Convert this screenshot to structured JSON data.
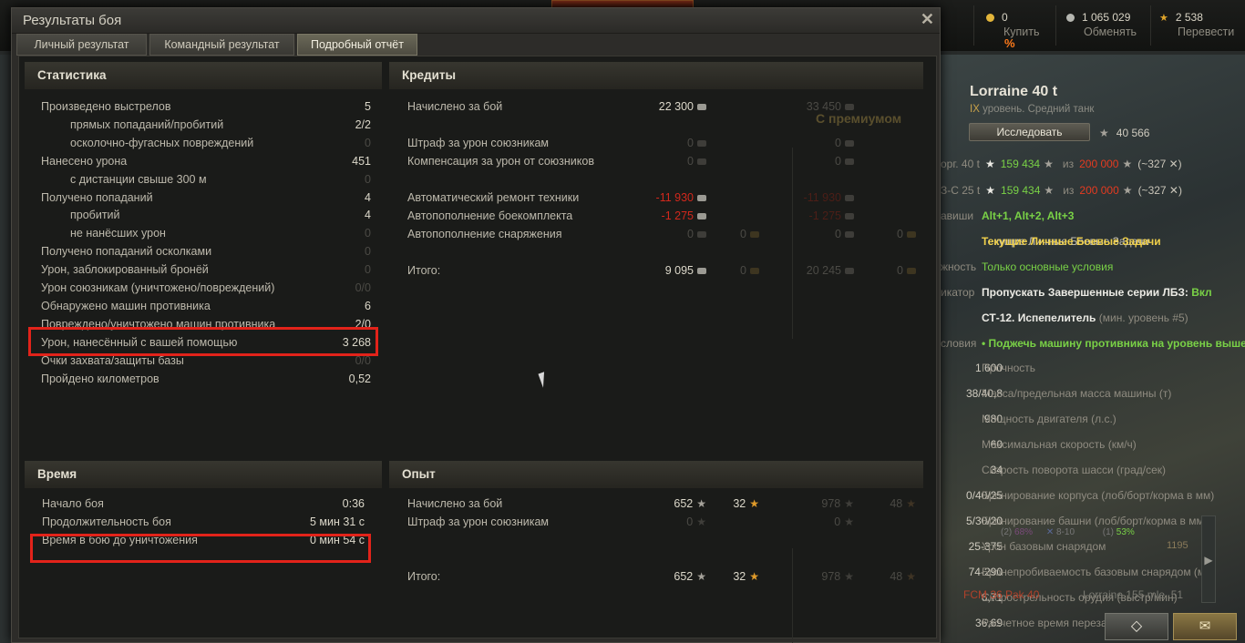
{
  "topbar": {
    "gold": {
      "value": "0",
      "action": "Купить",
      "discount": "%"
    },
    "silver": {
      "value": "1 065 029",
      "action": "Обменять"
    },
    "free_xp": {
      "value": "2 538",
      "action": "Перевести"
    }
  },
  "vehicle": {
    "name": "Lorraine 40 t",
    "tier": "IX",
    "subtitle": "уровень. Средний танк",
    "research_label": "Исследовать",
    "research_xp": "40 566",
    "compare_rows": [
      {
        "label": "орг. 40 t",
        "value": "159 434",
        "of": "из",
        "total": "200 000",
        "diff": "(~327 ✕)"
      },
      {
        "label": "З-С 25 t",
        "value": "159 434",
        "of": "из",
        "total": "200 000",
        "diff": "(~327 ✕)"
      }
    ],
    "hotkeys_label": "авиши",
    "hotkeys": "Alt+1, Alt+2, Alt+3",
    "missions_title": "Текущие Личные Боевые Задачи",
    "difficulty_label": "жность",
    "difficulty": "Только основные условия",
    "indicator_label": "икатор",
    "indicator": "Пропускать Завершенные серии ЛБЗ:",
    "indicator_value": "Вкл",
    "mission": "СТ-12. Испепелитель",
    "mission_min": "(мин. уровень #5)",
    "conditions_label": "словия",
    "condition": "• Поджечь машину противника на уровень выше.",
    "specs": [
      {
        "num": "1 600",
        "label": "Прочность"
      },
      {
        "num": "38/40,8",
        "label": "Масса/предельная масса машины (т)"
      },
      {
        "num": "980",
        "label": "Мощность двигателя (л.с.)"
      },
      {
        "num": "60",
        "label": "Максимальная скорость (км/ч)"
      },
      {
        "num": "34",
        "label": "Скорость поворота шасси (град/сек)"
      },
      {
        "num": "0/40/25",
        "label": "Бронирование корпуса (лоб/борт/корма в мм)"
      },
      {
        "num": "5/30/20",
        "label": "Бронирование башни (лоб/борт/корма в мм)"
      },
      {
        "num": "25-375",
        "label": "Урон базовым снарядом"
      },
      {
        "num": "74-290",
        "label": "Бронепробиваемость базовым снарядом (мм)"
      },
      {
        "num": "6,71",
        "label": "Скорострельность орудия (выстр/мин)"
      },
      {
        "num": "36,69",
        "label": "Расчетное время перезар"
      }
    ],
    "overlay": {
      "a": "(2)",
      "b": "68%",
      "c": "8-10",
      "d": "(1)",
      "e": "53%",
      "f": "1195",
      "gun": "FCM 36 Pak 40",
      "gun2": "Lorraine 155 mle. 51"
    }
  },
  "dialog": {
    "title": "Результаты боя",
    "close": "✕",
    "tabs": [
      "Личный результат",
      "Командный результат",
      "Подробный отчёт"
    ],
    "stats": {
      "header": "Статистика",
      "rows": [
        {
          "label": "Произведено выстрелов",
          "value": "5",
          "indent": false,
          "dim": false
        },
        {
          "label": "прямых попаданий/пробитий",
          "value": "2/2",
          "indent": true,
          "dim": false
        },
        {
          "label": "осколочно-фугасных повреждений",
          "value": "0",
          "indent": true,
          "dim": true
        },
        {
          "label": "Нанесено урона",
          "value": "451",
          "indent": false,
          "dim": false
        },
        {
          "label": "с дистанции свыше 300 м",
          "value": "0",
          "indent": true,
          "dim": true
        },
        {
          "label": "Получено попаданий",
          "value": "4",
          "indent": false,
          "dim": false
        },
        {
          "label": "пробитий",
          "value": "4",
          "indent": true,
          "dim": false
        },
        {
          "label": "не нанёсших урон",
          "value": "0",
          "indent": true,
          "dim": true
        },
        {
          "label": "Получено попаданий осколками",
          "value": "0",
          "indent": false,
          "dim": true
        },
        {
          "label": "Урон, заблокированный бронёй",
          "value": "0",
          "indent": false,
          "dim": true
        },
        {
          "label": "Урон союзникам (уничтожено/повреждений)",
          "value": "0/0",
          "indent": false,
          "dim": true
        },
        {
          "label": "Обнаружено машин противника",
          "value": "6",
          "indent": false,
          "dim": false
        },
        {
          "label": "Повреждено/уничтожено машин противника",
          "value": "2/0",
          "indent": false,
          "dim": false
        },
        {
          "label": "Урон, нанесённый с вашей помощью",
          "value": "3 268",
          "indent": false,
          "dim": false
        },
        {
          "label": "Очки захвата/защиты базы",
          "value": "0/0",
          "indent": false,
          "dim": true
        },
        {
          "label": "Пройдено километров",
          "value": "0,52",
          "indent": false,
          "dim": false
        }
      ]
    },
    "credits": {
      "header": "Кредиты",
      "premium_label": "С премиумом",
      "rows": [
        {
          "label": "Начислено за бой",
          "c": "22 300",
          "g": "",
          "pc": "33 450",
          "pg": ""
        },
        {
          "label": "Штраф за урон союзникам",
          "c": "0",
          "g": "",
          "pc": "0",
          "pg": ""
        },
        {
          "label": "Компенсация за урон от союзников",
          "c": "0",
          "g": "",
          "pc": "0",
          "pg": ""
        },
        {
          "label": "Автоматический ремонт техники",
          "c": "-11 930",
          "g": "",
          "pc": "-11 930",
          "pg": ""
        },
        {
          "label": "Автопополнение боекомплекта",
          "c": "-1 275",
          "g": "",
          "pc": "-1 275",
          "pg": ""
        },
        {
          "label": "Автопополнение снаряжения",
          "c": "0",
          "g": "0",
          "pc": "0",
          "pg": "0"
        },
        {
          "label": "Итого:",
          "c": "9 095",
          "g": "0",
          "pc": "20 245",
          "pg": "0"
        }
      ]
    },
    "time": {
      "header": "Время",
      "rows": [
        {
          "label": "Начало боя",
          "value": "0:36"
        },
        {
          "label": "Продолжительность боя",
          "value": "5 мин 31 с"
        },
        {
          "label": "Время в бою до уничтожения",
          "value": "0 мин 54 с"
        }
      ]
    },
    "xp": {
      "header": "Опыт",
      "rows": [
        {
          "label": "Начислено за бой",
          "x": "652",
          "f": "32",
          "px": "978",
          "pf": "48"
        },
        {
          "label": "Штраф за урон союзникам",
          "x": "0",
          "f": "",
          "px": "0",
          "pf": ""
        },
        {
          "label": "Итого:",
          "x": "652",
          "f": "32",
          "px": "978",
          "pf": "48"
        }
      ]
    }
  }
}
